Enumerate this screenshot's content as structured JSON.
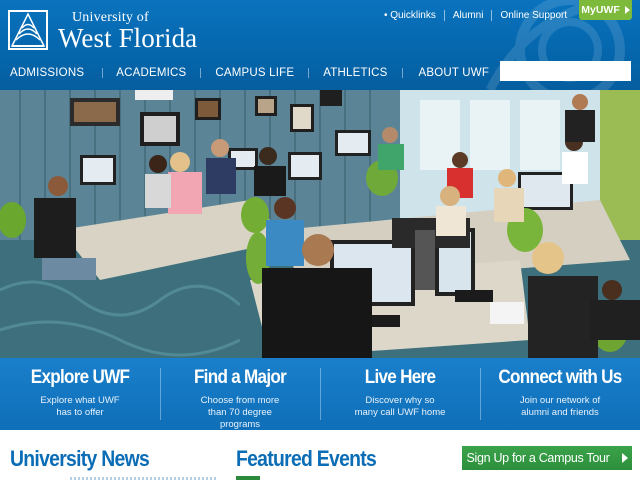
{
  "header": {
    "logo_line1": "University of",
    "logo_line2": "West Florida",
    "utility_links": [
      "Quicklinks",
      "Alumni",
      "Online Support"
    ],
    "myuwf_label": "MyUWF",
    "nav_items": [
      "ADMISSIONS",
      "ACADEMICS",
      "CAMPUS LIFE",
      "ATHLETICS",
      "ABOUT UWF"
    ],
    "search_placeholder": ""
  },
  "hero": {
    "description": "Students working at computers in a campus computer lab"
  },
  "promos": [
    {
      "title": "Explore UWF",
      "description": "Explore what UWF has to offer"
    },
    {
      "title": "Find a Major",
      "description": "Choose from more than 70 degree programs"
    },
    {
      "title": "Live Here",
      "description": "Discover why so many call UWF home"
    },
    {
      "title": "Connect with Us",
      "description": "Join our network of alumni and friends"
    }
  ],
  "sections": {
    "news_title": "University News",
    "events_title": "Featured Events",
    "tour_button": "Sign Up for a Campus Tour"
  },
  "colors": {
    "header_blue": "#0566ac",
    "promo_blue": "#1a7fcb",
    "accent_green": "#7dba3c",
    "button_green": "#2d8f3c",
    "heading_blue": "#0b6db5"
  },
  "icons": [
    "uwf-logo-icon",
    "quicklinks-bullet-icon",
    "chevron-right-icon"
  ]
}
